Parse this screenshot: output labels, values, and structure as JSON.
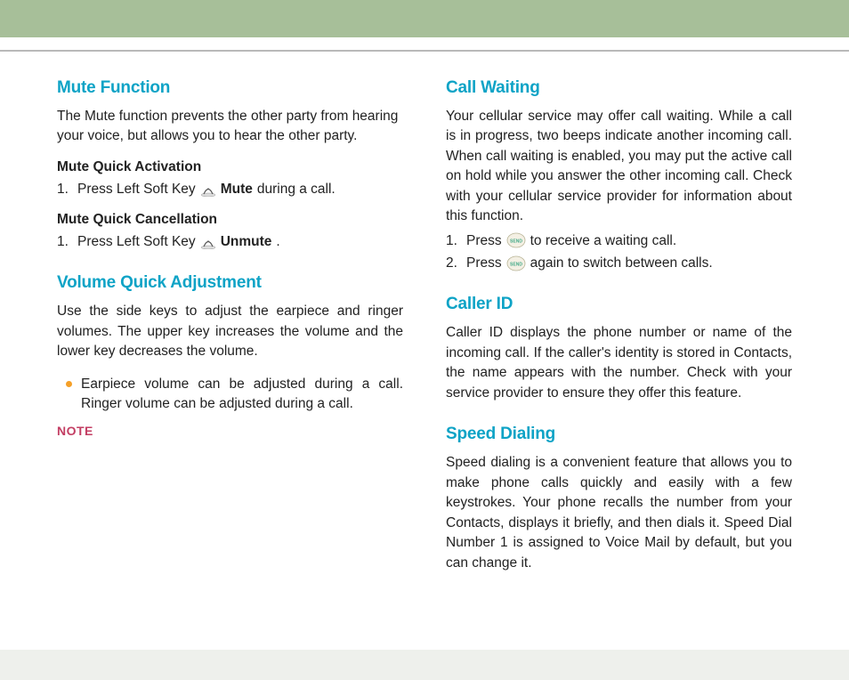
{
  "left": {
    "mute": {
      "heading": "Mute Function",
      "desc": "The Mute function prevents the other party from hearing your voice, but allows you to hear the other party.",
      "activation_sub": "Mute Quick Activation",
      "activation_step_num": "1.",
      "activation_step_pre": "Press Left Soft Key",
      "activation_step_bold": "Mute",
      "activation_step_post": " during a call.",
      "cancel_sub": "Mute Quick Cancellation",
      "cancel_step_num": "1.",
      "cancel_step_pre": "Press Left Soft Key",
      "cancel_step_bold": "Unmute",
      "cancel_step_post": "."
    },
    "volume": {
      "heading": "Volume Quick Adjustment",
      "desc": "Use the side keys to adjust the earpiece and ringer volumes. The upper key increases the volume and the lower key decreases the volume.",
      "bullet": "Earpiece volume can be adjusted during a call. Ringer volume can be adjusted during a call.",
      "note": "NOTE"
    }
  },
  "right": {
    "callwaiting": {
      "heading": "Call Waiting",
      "desc": "Your cellular service may offer call waiting. While a call is in progress, two beeps indicate another incoming call. When call waiting is enabled, you may put the active call on hold while you answer the other incoming call. Check with your cellular service provider for information about this function.",
      "step1_num": "1.",
      "step1_pre": "Press",
      "step1_post": " to receive a waiting call.",
      "step2_num": "2.",
      "step2_pre": "Press",
      "step2_post": " again to switch between calls."
    },
    "callerid": {
      "heading": "Caller ID",
      "desc": "Caller ID displays the phone number or name of the incoming call. If the caller's identity is stored in Contacts, the name appears with the number. Check with your service provider to ensure they offer this feature."
    },
    "speed": {
      "heading": "Speed Dialing",
      "desc": "Speed dialing is a convenient feature that allows you to make phone calls quickly and easily with a few keystrokes. Your phone recalls the number from your Contacts, displays it briefly, and then dials it. Speed Dial Number 1 is assigned to Voice Mail by default, but you can change it."
    }
  }
}
